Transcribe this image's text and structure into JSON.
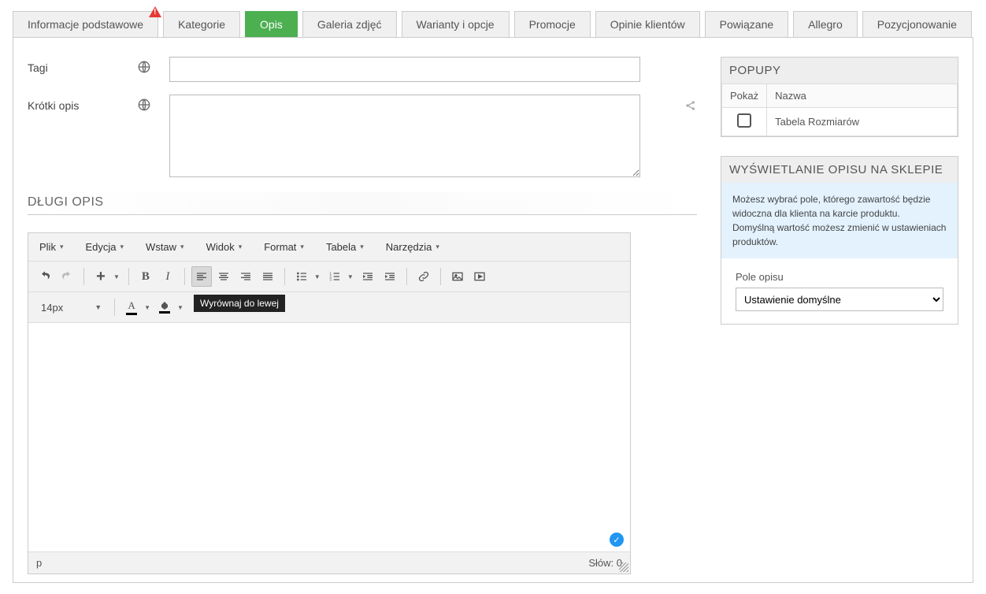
{
  "tabs": [
    {
      "label": "Informacje podstawowe",
      "warn": true
    },
    {
      "label": "Kategorie"
    },
    {
      "label": "Opis",
      "active": true
    },
    {
      "label": "Galeria zdjęć"
    },
    {
      "label": "Warianty i opcje"
    },
    {
      "label": "Promocje"
    },
    {
      "label": "Opinie klientów"
    },
    {
      "label": "Powiązane"
    },
    {
      "label": "Allegro"
    },
    {
      "label": "Pozycjonowanie"
    }
  ],
  "fields": {
    "tagi_label": "Tagi",
    "tagi_value": "",
    "krotki_label": "Krótki opis",
    "krotki_value": ""
  },
  "long_desc_header": "DŁUGI OPIS",
  "editor": {
    "menus": [
      "Plik",
      "Edycja",
      "Wstaw",
      "Widok",
      "Format",
      "Tabela",
      "Narzędzia"
    ],
    "font_size": "14px",
    "tooltip": "Wyrównaj do lewej",
    "status_path": "p",
    "word_count_label": "Słów:",
    "word_count": "0"
  },
  "popupy": {
    "header": "POPUPY",
    "col_show": "Pokaż",
    "col_name": "Nazwa",
    "row1_name": "Tabela Rozmiarów"
  },
  "display": {
    "header": "WYŚWIETLANIE OPISU NA SKLEPIE",
    "info": "Możesz wybrać pole, którego zawartość będzie widoczna dla klienta na karcie produktu.\nDomyślną wartość możesz zmienić w ustawieniach produktów.",
    "field_label": "Pole opisu",
    "select_value": "Ustawienie domyślne"
  }
}
